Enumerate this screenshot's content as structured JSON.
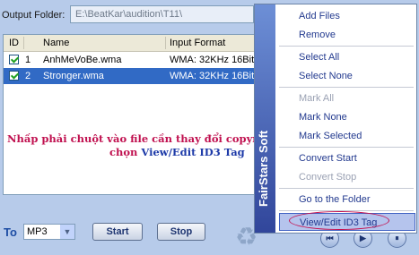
{
  "output": {
    "label": "Output Folder:",
    "path": "E:\\BeatKar\\audition\\T11\\"
  },
  "list": {
    "headers": [
      "ID",
      "Name",
      "Input Format"
    ],
    "rows": [
      {
        "id": "1",
        "name": "AnhMeVoBe.wma",
        "format": "WMA: 32KHz 16Bit"
      },
      {
        "id": "2",
        "name": "Stronger.wma",
        "format": "WMA: 32KHz 16Bit"
      }
    ]
  },
  "note": {
    "line1": "Nhấp phải chuột vào file cần thay đổi copyright",
    "line2_prefix": "chọn ",
    "line2_link": "View/Edit ID3 Tag"
  },
  "bottom": {
    "to_label": "To",
    "format_value": "MP3",
    "start_label": "Start",
    "stop_label": "Stop"
  },
  "menu": {
    "brand": "FairStars Soft",
    "items": [
      {
        "label": "Add Files",
        "enabled": true
      },
      {
        "label": "Remove",
        "enabled": true
      },
      {
        "label": "Select All",
        "enabled": true
      },
      {
        "label": "Select None",
        "enabled": true
      },
      {
        "label": "Mark All",
        "enabled": false
      },
      {
        "label": "Mark None",
        "enabled": true
      },
      {
        "label": "Mark Selected",
        "enabled": true
      },
      {
        "label": "Convert Start",
        "enabled": true
      },
      {
        "label": "Convert Stop",
        "enabled": false
      },
      {
        "label": "Go to the Folder",
        "enabled": true
      },
      {
        "label": "View/Edit ID3 Tag",
        "enabled": true
      }
    ]
  },
  "colors": {
    "accent": "#316ac5",
    "note_red": "#c0104f",
    "note_blue": "#1d3aa8"
  }
}
